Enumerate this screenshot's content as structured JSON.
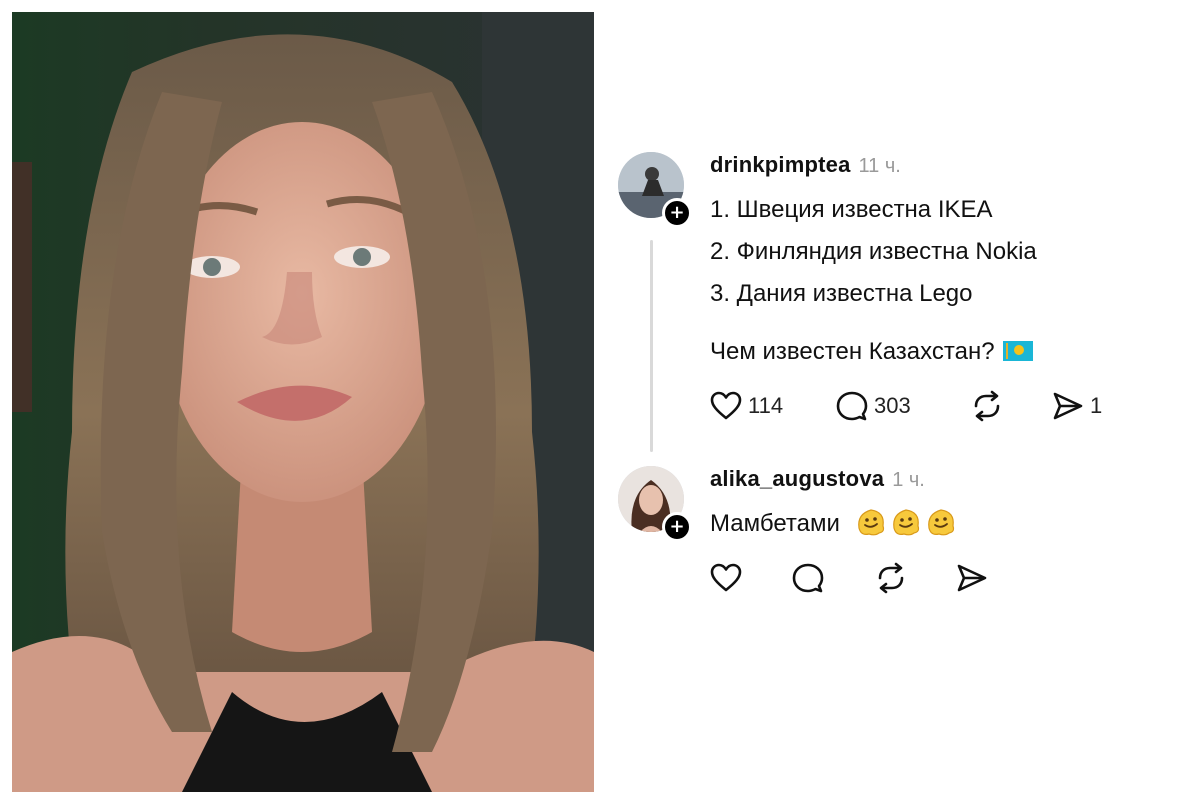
{
  "video": {
    "icon": "person-video-frame"
  },
  "thread": {
    "post": {
      "username": "drinkpimptea",
      "time": "11 ч.",
      "lines": [
        "1. Швеция известна IKEA",
        "2. Финляндия известна Nokia",
        "3. Дания известна Lego"
      ],
      "question": "Чем известен Казахстан?",
      "flag_icon": "kazakhstan-flag-icon",
      "stats": {
        "likes": "114",
        "comments": "303",
        "shares": "1"
      },
      "follow_glyph": "+"
    },
    "reply": {
      "username": "alika_augustova",
      "time": "1 ч.",
      "text": "Мамбетами",
      "emoji_icon": "melting-face-emoji",
      "follow_glyph": "+"
    }
  },
  "colors": {
    "text": "#111111",
    "muted": "#9a9a9a",
    "divider": "#d9d9d9",
    "badge": "#000000"
  }
}
